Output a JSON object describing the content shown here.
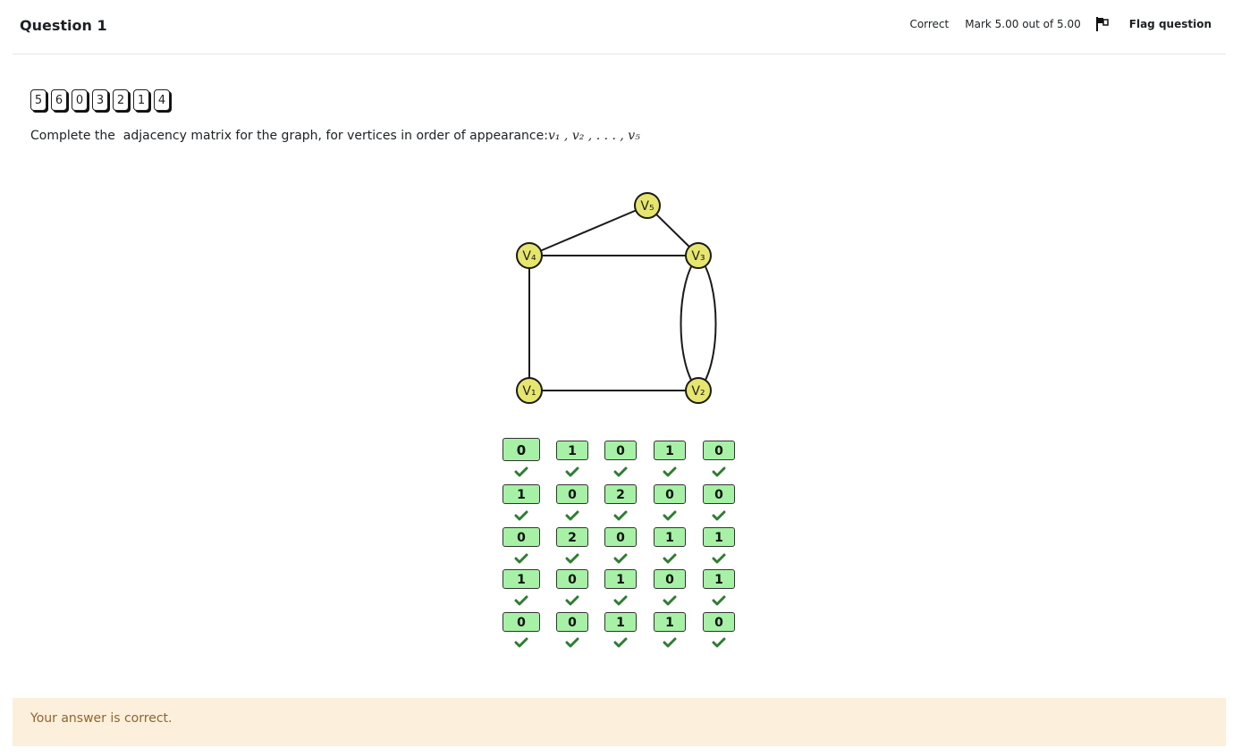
{
  "header": {
    "title": "Question 1",
    "status": "Correct",
    "mark": "Mark 5.00 out of 5.00",
    "flag_label": "Flag question"
  },
  "tokens": [
    "5",
    "6",
    "0",
    "3",
    "2",
    "1",
    "4"
  ],
  "prompt": {
    "text": "Complete the  adjacency matrix for the graph, for vertices in order of appearance:",
    "math": "v₁ , v₂ , . . . , v₅"
  },
  "graph": {
    "vertices": [
      {
        "id": "v1",
        "label": "V₁"
      },
      {
        "id": "v2",
        "label": "V₂"
      },
      {
        "id": "v3",
        "label": "V₃"
      },
      {
        "id": "v4",
        "label": "V₄"
      },
      {
        "id": "v5",
        "label": "V₅"
      }
    ],
    "edges": [
      [
        "v1",
        "v2"
      ],
      [
        "v1",
        "v4"
      ],
      [
        "v2",
        "v3"
      ],
      [
        "v2",
        "v3"
      ],
      [
        "v3",
        "v4"
      ],
      [
        "v3",
        "v5"
      ],
      [
        "v4",
        "v5"
      ]
    ],
    "vertex_color": "#e6e66e"
  },
  "matrix": [
    [
      "0",
      "1",
      "0",
      "1",
      "0"
    ],
    [
      "1",
      "0",
      "2",
      "0",
      "0"
    ],
    [
      "0",
      "2",
      "0",
      "1",
      "1"
    ],
    [
      "1",
      "0",
      "1",
      "0",
      "1"
    ],
    [
      "0",
      "0",
      "1",
      "1",
      "0"
    ]
  ],
  "cell_color": "#a6f1a6",
  "tick_color": "#2e7d32",
  "feedback": "Your answer is correct."
}
